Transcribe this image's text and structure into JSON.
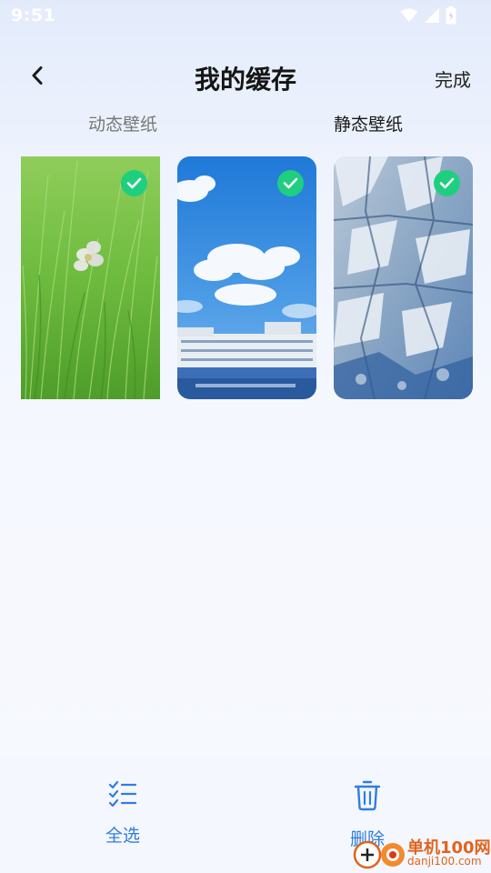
{
  "status_bar": {
    "time": "9:51",
    "icons": [
      "wifi-icon",
      "signal-icon",
      "battery-charging-icon"
    ]
  },
  "header": {
    "title": "我的缓存",
    "back_icon": "chevron-left-icon",
    "done_label": "完成"
  },
  "tabs": [
    {
      "label": "动态壁纸",
      "active": false
    },
    {
      "label": "静态壁纸",
      "active": true
    }
  ],
  "wallpapers": [
    {
      "subject": "green grass with white flower",
      "selected": true
    },
    {
      "subject": "blue sky with clouds over white building",
      "selected": true
    },
    {
      "subject": "blue glacier ice",
      "selected": true
    }
  ],
  "bottom_actions": {
    "select_all": {
      "label": "全选",
      "icon": "checklist-icon"
    },
    "delete": {
      "label": "删除",
      "icon": "trash-icon"
    }
  },
  "watermark": {
    "brand": "单机100网",
    "domain": "danji100.com"
  },
  "colors": {
    "accent": "#2f7de0",
    "check": "#1fcf7f",
    "watermark": "#e0641e"
  }
}
